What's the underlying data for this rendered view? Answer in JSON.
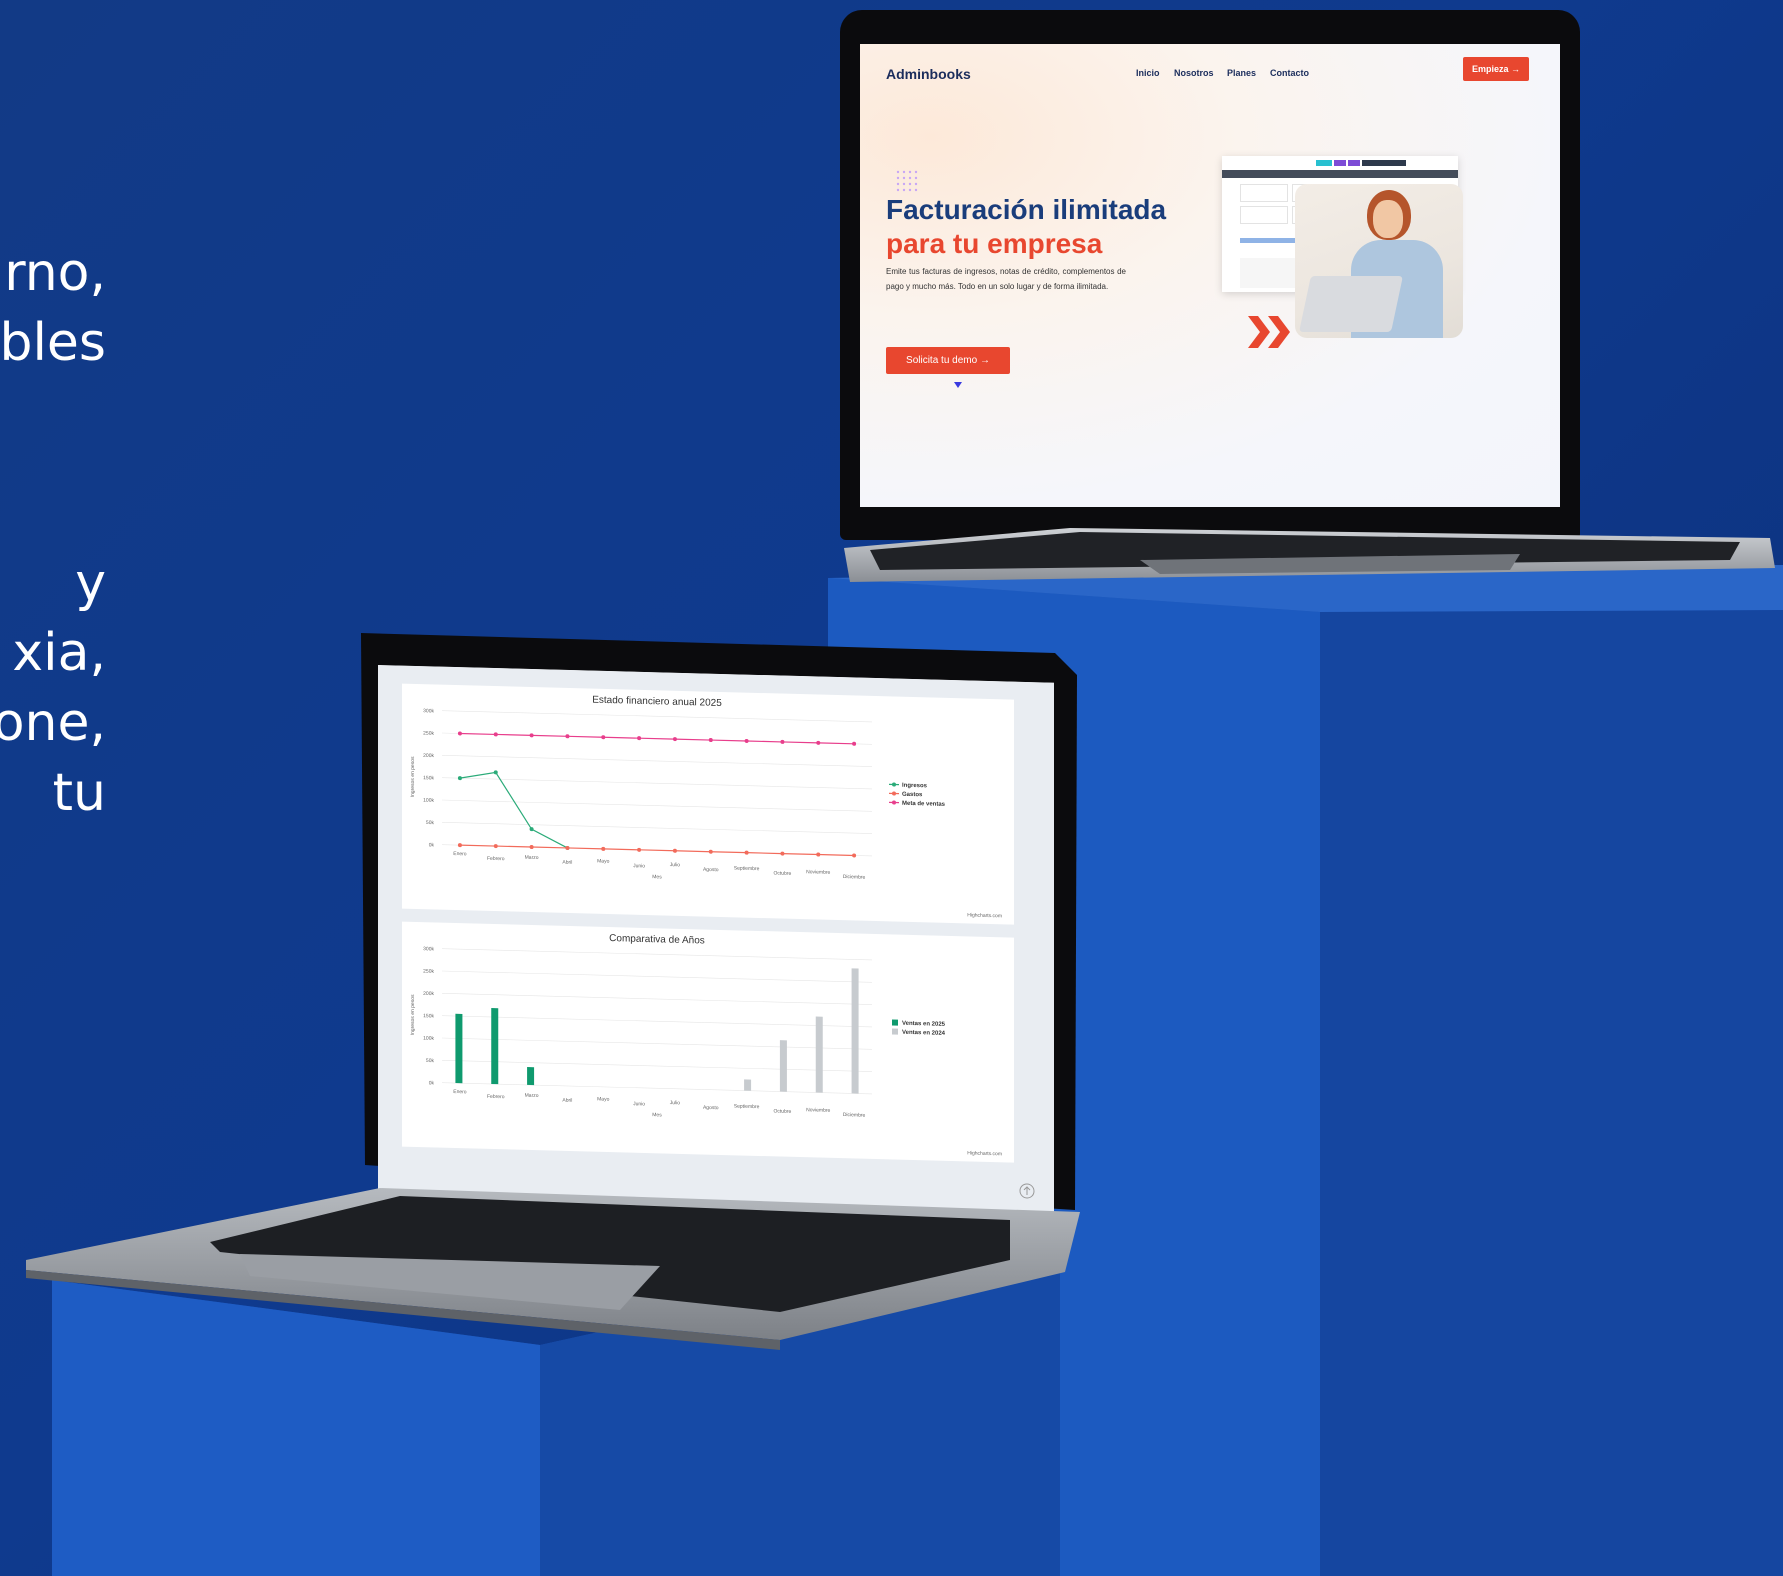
{
  "left_text": {
    "line1": "rno,",
    "line2": "bles",
    "line3": "y",
    "line4": "xia,",
    "line5": "one,",
    "line6": "tu"
  },
  "site": {
    "logo": "Adminbooks",
    "nav": [
      "Inicio",
      "Nosotros",
      "Planes",
      "Contacto"
    ],
    "cta_label": "Empieza →",
    "hero_line1": "Facturación ilimitada",
    "hero_line2": "para tu empresa",
    "hero_sub": "Emite tus facturas de ingresos, notas de crédito, complementos de pago y mucho más. Todo en un solo lugar y de forma ilimitada.",
    "demo_button": "Solicita tu demo →",
    "brand_color": "#e8472f",
    "navy_color": "#1a3d7b"
  },
  "dashboard": {
    "chart1_title": "Estado financiero anual 2025",
    "chart2_title": "Comparativa de Años",
    "credit": "Highcharts.com",
    "yaxis_label": "Ingresos en pesos",
    "xaxis_label": "Mes"
  },
  "chart_data": [
    {
      "type": "line",
      "title": "Estado financiero anual 2025",
      "xlabel": "Mes",
      "ylabel": "Ingresos en pesos",
      "categories": [
        "Enero",
        "Febrero",
        "Marzo",
        "Abril",
        "Mayo",
        "Junio",
        "Julio",
        "Agosto",
        "Septiembre",
        "Octubre",
        "Noviembre",
        "Diciembre"
      ],
      "yticks": [
        "0k",
        "50k",
        "100k",
        "150k",
        "200k",
        "250k",
        "300k"
      ],
      "ylim": [
        0,
        300000
      ],
      "series": [
        {
          "name": "Ingresos",
          "color": "#2bab79",
          "values": [
            150000,
            165000,
            40000,
            0,
            null,
            null,
            null,
            null,
            null,
            null,
            null,
            null
          ]
        },
        {
          "name": "Gastos",
          "color": "#f26b5b",
          "values": [
            0,
            0,
            0,
            0,
            0,
            0,
            0,
            0,
            0,
            0,
            0,
            0
          ]
        },
        {
          "name": "Meta de ventas",
          "color": "#e83e8c",
          "values": [
            250000,
            250000,
            250000,
            250000,
            250000,
            250000,
            250000,
            250000,
            250000,
            250000,
            250000,
            250000
          ]
        }
      ],
      "legend": "right"
    },
    {
      "type": "bar",
      "title": "Comparativa de Años",
      "xlabel": "Mes",
      "ylabel": "Ingresos en pesos",
      "categories": [
        "Enero",
        "Febrero",
        "Marzo",
        "Abril",
        "Mayo",
        "Junio",
        "Julio",
        "Agosto",
        "Septiembre",
        "Octubre",
        "Noviembre",
        "Diciembre"
      ],
      "yticks": [
        "0k",
        "50k",
        "100k",
        "150k",
        "200k",
        "250k",
        "300k"
      ],
      "ylim": [
        0,
        300000
      ],
      "series": [
        {
          "name": "Ventas en 2025",
          "color": "#0f9a6e",
          "values": [
            155000,
            170000,
            40000,
            0,
            0,
            0,
            0,
            0,
            0,
            0,
            0,
            0
          ]
        },
        {
          "name": "Ventas en 2024",
          "color": "#c7cbcf",
          "values": [
            0,
            0,
            0,
            0,
            0,
            0,
            0,
            0,
            25000,
            115000,
            170000,
            280000
          ]
        }
      ],
      "legend": "right"
    }
  ]
}
